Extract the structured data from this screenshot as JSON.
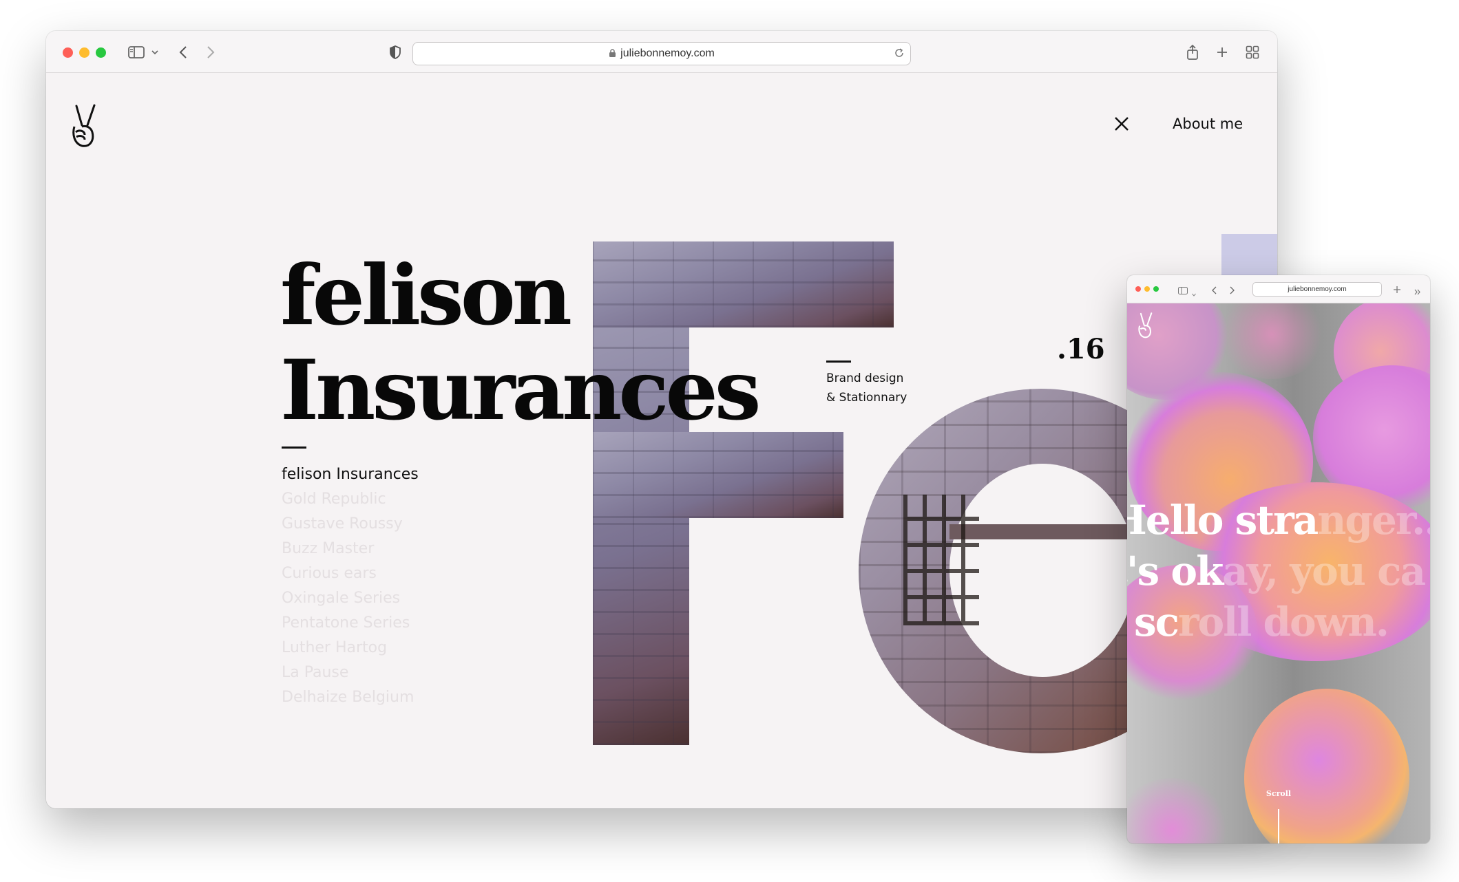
{
  "main_window": {
    "url": "juliebonnemoy.com",
    "nav": {
      "about_label": "About me"
    },
    "hero": {
      "title_line1": "felison",
      "title_line2": "Insurances",
      "project_number": ".16",
      "tagline_line1": "Brand design",
      "tagline_line2": "& Stationnary"
    },
    "project_list": [
      "felison Insurances",
      "Gold Republic",
      "Gustave Roussy",
      "Buzz Master",
      "Curious ears",
      "Oxingale Series",
      "Pentatone Series",
      "Luther Hartog",
      "La Pause",
      "Delhaize Belgium"
    ],
    "active_project_index": 0
  },
  "secondary_window": {
    "url": "juliebonnemoy.com",
    "hero_line1_solid": "Hello stra",
    "hero_line1_faded": "nger...",
    "hero_line2_solid": "t's ok",
    "hero_line2_faded": "ay, you ca",
    "hero_line3_solid": "sc",
    "hero_line3_faded": "roll down.",
    "scroll_label": "Scroll"
  },
  "colors": {
    "page_background": "#f6f3f4",
    "text_primary": "#080808",
    "list_inactive": "#e4dfe1",
    "blob_pink": "#d77ddb",
    "blob_orange": "#f6ad6e",
    "lavender_strip": "#cccbe7"
  },
  "icons": [
    "sidebar-icon",
    "chevron-down-icon",
    "back-icon",
    "forward-icon",
    "shield-icon",
    "lock-icon",
    "reload-icon",
    "share-icon",
    "new-tab-icon",
    "tab-overview-icon",
    "peace-hand-logo-icon",
    "close-icon",
    "double-chevron-icon"
  ]
}
